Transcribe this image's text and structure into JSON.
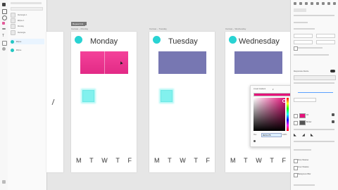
{
  "layers": {
    "items": [
      "Rectangle 1",
      "Ellipse 1",
      "Monday",
      "Rectangle",
      "Ellipse"
    ]
  },
  "artboards": [
    {
      "label": "Canvas – Monday",
      "title": "Monday"
    },
    {
      "label": "Canvas – Tuesday",
      "title": "Tuesday"
    },
    {
      "label": "Canvas – Wednesday",
      "title": "Wednesday"
    }
  ],
  "artboard_tag": "Repeat Grid",
  "week_letters": [
    "M",
    "T",
    "W",
    "T",
    "F"
  ],
  "picker": {
    "mode": "Linear Gradient",
    "hex_label": "Hex",
    "hex_value": "#E5127B",
    "alpha_value": "100%"
  },
  "inspector": {
    "responsive_resize": "Responsive Resize",
    "fill_label": "Fill",
    "border_label": "Border",
    "shadow_label": "Drop Shadow",
    "inner_shadow_label": "Inner Shadow",
    "blur_label": "Background Blur"
  },
  "colors": {
    "fill_swatch": "#e5127b",
    "border_swatch": "#555555",
    "accent_teal": "#29d3d3",
    "rect_purple": "#7777b2"
  }
}
